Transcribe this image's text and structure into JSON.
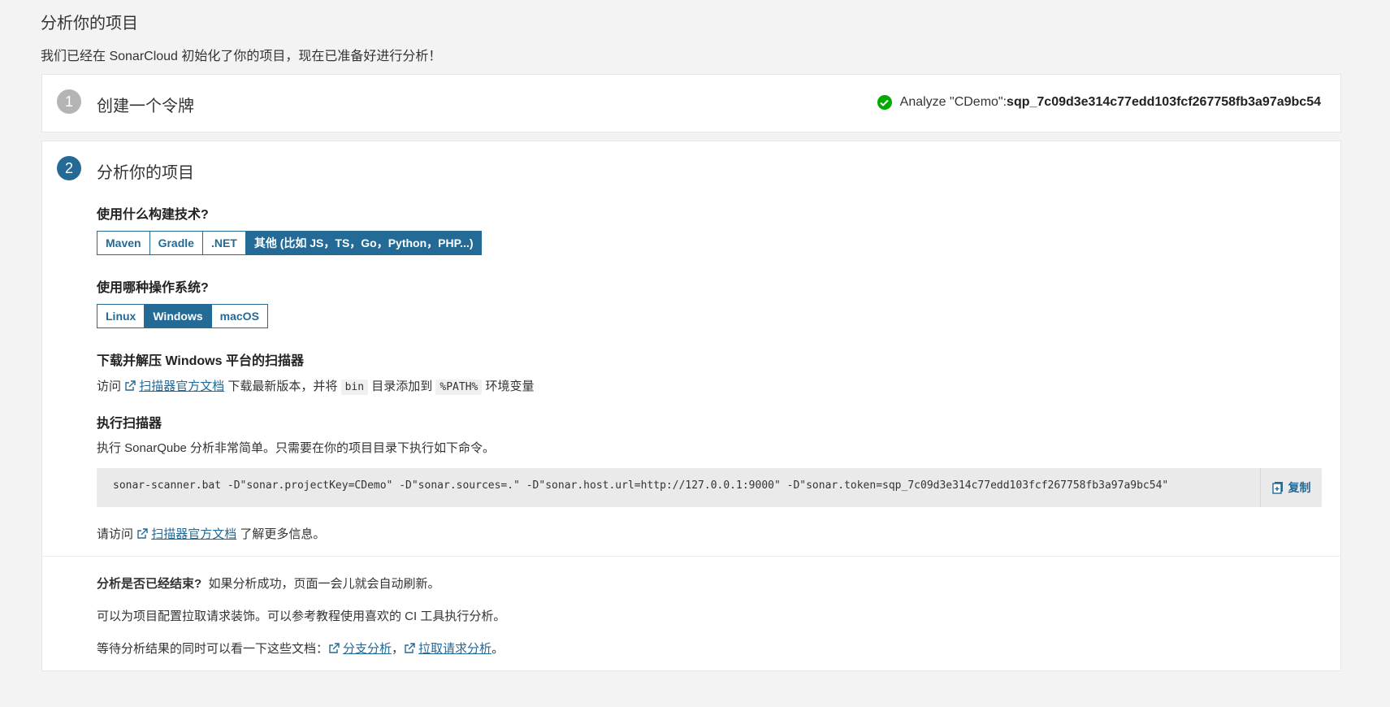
{
  "header": {
    "title": "分析你的项目",
    "description": "我们已经在 SonarCloud 初始化了你的项目，现在已准备好进行分析！"
  },
  "step1": {
    "number": "1",
    "title": "创建一个令牌",
    "token_label": "Analyze \"CDemo\":",
    "token_value": "sqp_7c09d3e314c77edd103fcf267758fb3a97a9bc54"
  },
  "step2": {
    "number": "2",
    "title": "分析你的项目",
    "build_question": "使用什么构建技术?",
    "build_options": [
      "Maven",
      "Gradle",
      ".NET",
      "其他 (比如 JS，TS，Go，Python，PHP...)"
    ],
    "os_question": "使用哪种操作系统?",
    "os_options": [
      "Linux",
      "Windows",
      "macOS"
    ],
    "download_title": "下载并解压 Windows 平台的扫描器",
    "download_prefix": "访问",
    "download_link": "扫描器官方文档",
    "download_middle": "下载最新版本，并将",
    "download_code1": "bin",
    "download_middle2": "目录添加到",
    "download_code2": "%PATH%",
    "download_suffix": "环境变量",
    "execute_title": "执行扫描器",
    "execute_desc": "执行 SonarQube 分析非常简单。只需要在你的项目目录下执行如下命令。",
    "command": "sonar-scanner.bat -D\"sonar.projectKey=CDemo\" -D\"sonar.sources=.\" -D\"sonar.host.url=http://127.0.0.1:9000\" -D\"sonar.token=sqp_7c09d3e314c77edd103fcf267758fb3a97a9bc54\"",
    "copy_label": "复制",
    "more_prefix": "请访问",
    "more_link": "扫描器官方文档",
    "more_suffix": "了解更多信息。"
  },
  "footer": {
    "done_question": "分析是否已经结束?",
    "done_text": "如果分析成功，页面一会儿就会自动刷新。",
    "pr_text": "可以为项目配置拉取请求装饰。可以参考教程使用喜欢的 CI 工具执行分析。",
    "docs_prefix": "等待分析结果的同时可以看一下这些文档：",
    "docs_link1": "分支分析",
    "docs_sep": "，",
    "docs_link2": "拉取请求分析",
    "docs_end": "。"
  },
  "colors": {
    "accent": "#236a97",
    "success": "#00aa00",
    "step_done": "#b4b4b4"
  }
}
